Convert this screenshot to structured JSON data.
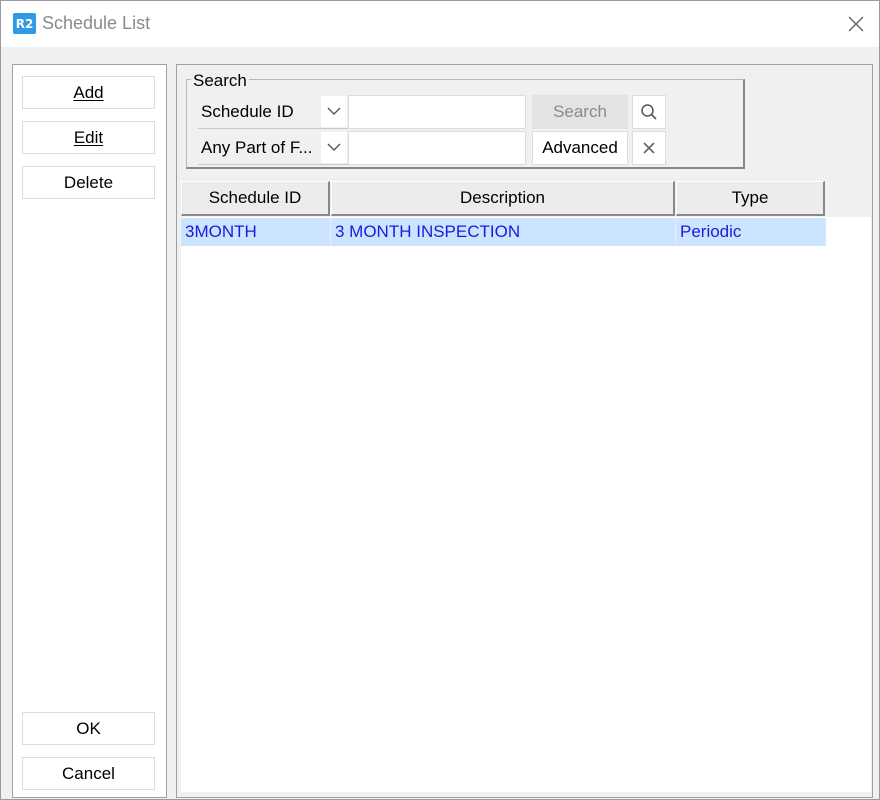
{
  "window": {
    "app_icon_text": "R2",
    "title": "Schedule List"
  },
  "sidebar": {
    "add_label": "Add",
    "edit_label": "Edit",
    "delete_label": "Delete",
    "ok_label": "OK",
    "cancel_label": "Cancel"
  },
  "search": {
    "group_label": "Search",
    "field_selected": "Schedule ID",
    "match_selected": "Any Part of F...",
    "search_button": "Search",
    "advanced_button": "Advanced",
    "search_value": "",
    "match_value": ""
  },
  "table": {
    "headers": [
      "Schedule ID",
      "Description",
      "Type"
    ],
    "rows": [
      [
        "3MONTH",
        "3 MONTH INSPECTION",
        "Periodic"
      ]
    ]
  },
  "icons": {
    "app": "r2-app-icon",
    "close": "close-icon",
    "search": "search-icon",
    "clear": "clear-icon",
    "dropdown": "chevron-down-icon"
  },
  "colors": {
    "selected_row": "#cce4ff",
    "row_text": "#1a1ae0",
    "app_icon": "#2f9ae8"
  }
}
